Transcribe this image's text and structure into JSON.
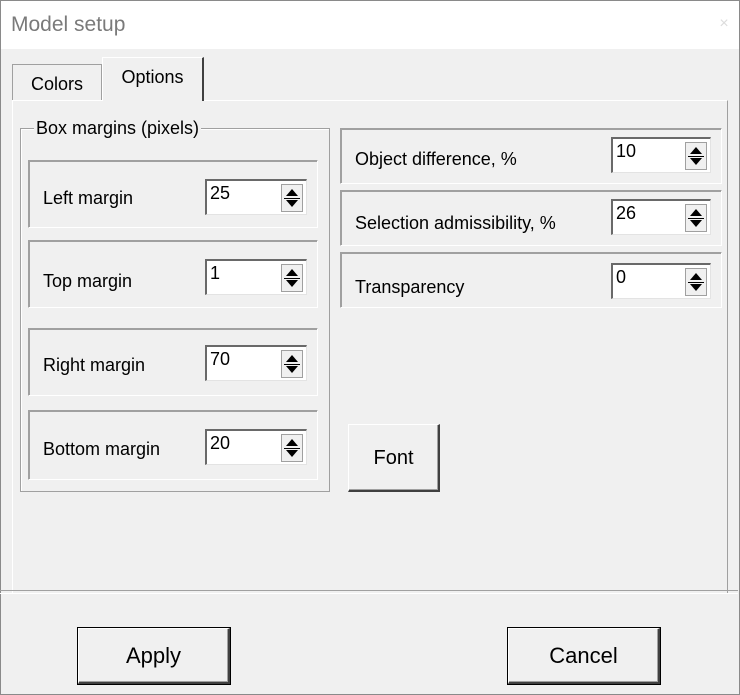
{
  "window": {
    "title": "Model setup",
    "close_glyph": "×"
  },
  "tabs": [
    {
      "label": "Colors",
      "selected": false
    },
    {
      "label": "Options",
      "selected": true
    }
  ],
  "box_margins": {
    "title": "Box margins (pixels)",
    "fields": [
      {
        "label": "Left margin",
        "value": "25"
      },
      {
        "label": "Top margin",
        "value": "1"
      },
      {
        "label": "Right margin",
        "value": "70"
      },
      {
        "label": "Bottom margin",
        "value": "20"
      }
    ]
  },
  "options": {
    "fields": [
      {
        "label": "Object difference, %",
        "value": "10"
      },
      {
        "label": "Selection admissibility, %",
        "value": "26"
      },
      {
        "label": "Transparency",
        "value": "0"
      }
    ],
    "font_button": "Font"
  },
  "footer": {
    "apply_label": "Apply",
    "cancel_label": "Cancel"
  },
  "icons": {
    "spin": "up-down-arrows-icon",
    "close": "close-icon"
  }
}
